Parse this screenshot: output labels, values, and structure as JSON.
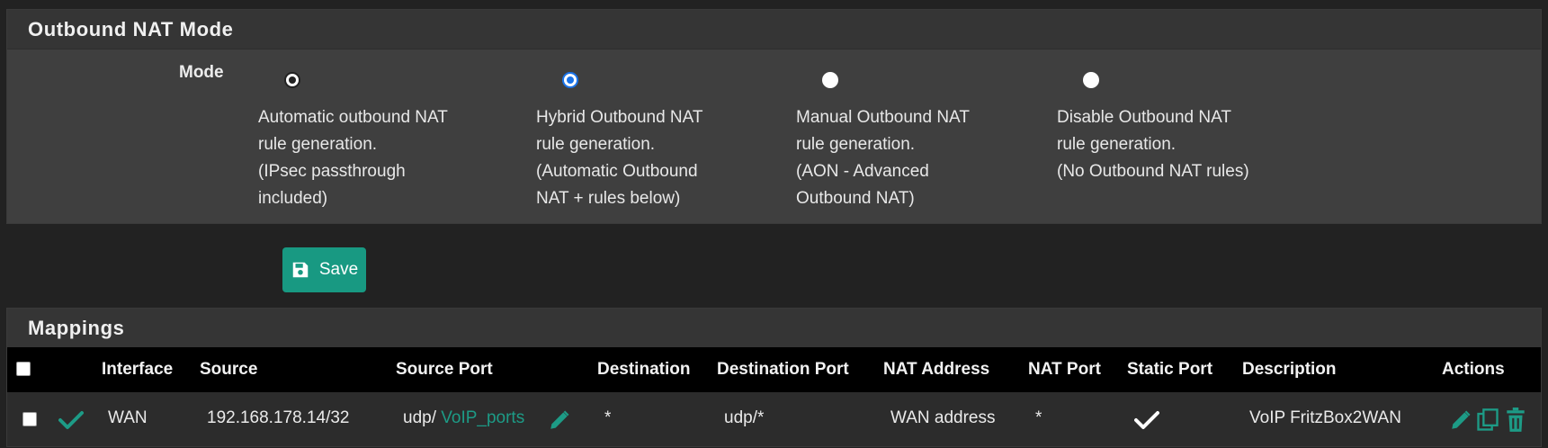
{
  "mode_panel": {
    "title": "Outbound NAT Mode",
    "mode_label": "Mode",
    "options": [
      {
        "lines": [
          "Automatic outbound NAT",
          "rule generation.",
          "(IPsec passthrough",
          "included)"
        ],
        "state": "checked-dark"
      },
      {
        "lines": [
          "Hybrid Outbound NAT",
          "rule generation.",
          "(Automatic Outbound",
          "NAT + rules below)"
        ],
        "state": "checked-blue"
      },
      {
        "lines": [
          "Manual Outbound NAT",
          "rule generation.",
          "(AON - Advanced",
          "Outbound NAT)"
        ],
        "state": "unchecked"
      },
      {
        "lines": [
          "Disable Outbound NAT",
          "rule generation.",
          "(No Outbound NAT rules)"
        ],
        "state": "unchecked"
      }
    ]
  },
  "save_button": {
    "label": "Save",
    "icon": "save-icon"
  },
  "mappings": {
    "title": "Mappings",
    "columns": [
      "Interface",
      "Source",
      "Source Port",
      "Destination",
      "Destination Port",
      "NAT Address",
      "NAT Port",
      "Static Port",
      "Description",
      "Actions"
    ],
    "rows": [
      {
        "enabled_icon": "check-icon",
        "interface": "WAN",
        "source": "192.168.178.14/32",
        "source_port_proto": "udp/",
        "source_port_alias": "VoIP_ports",
        "destination": "*",
        "destination_port": "udp/*",
        "nat_address": "WAN address",
        "nat_port": "*",
        "static_port_icon": "check-icon",
        "description": "VoIP FritzBox2WAN",
        "action_icons": [
          "pencil-icon",
          "copy-icon",
          "trash-icon"
        ]
      }
    ]
  },
  "colors": {
    "accent": "#189982",
    "link": "#1d9b86",
    "radio_selected": "#1a73e8",
    "background": "#222222"
  }
}
